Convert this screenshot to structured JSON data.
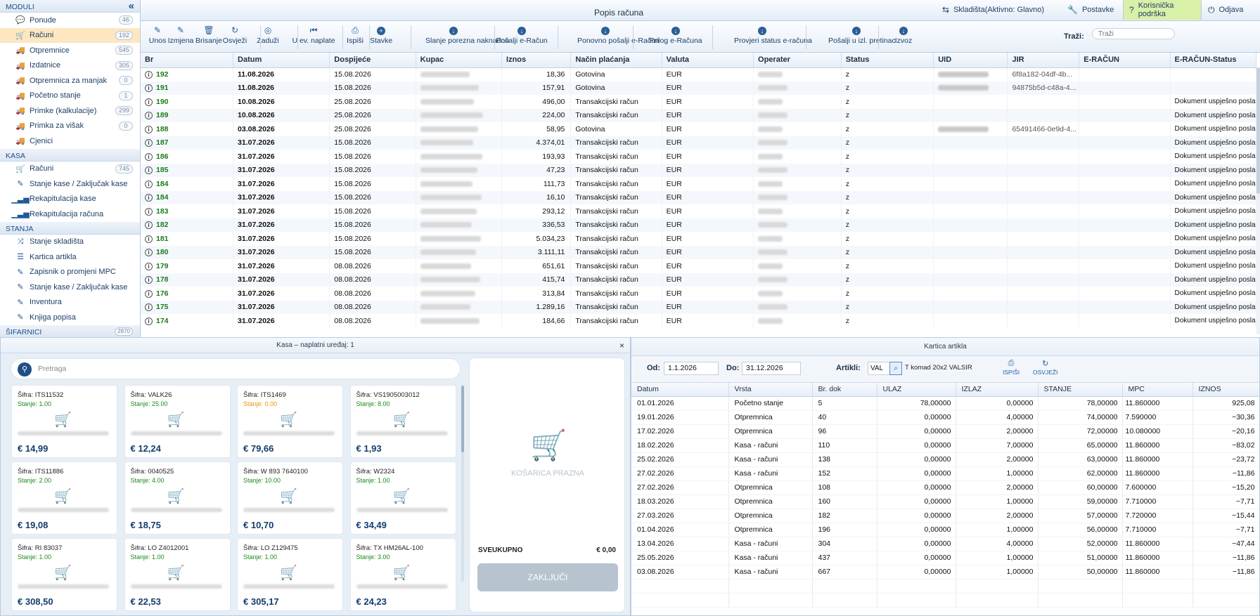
{
  "sidebar": {
    "sections": [
      {
        "title": "MODULI",
        "items": [
          {
            "label": "Ponude",
            "count": "46",
            "icon": "chat-bubble-icon"
          },
          {
            "label": "Računi",
            "count": "192",
            "icon": "cart-icon",
            "active": true
          },
          {
            "label": "Otpremnice",
            "count": "545",
            "icon": "truck-icon"
          },
          {
            "label": "Izdatnice",
            "count": "305",
            "icon": "truck-icon"
          },
          {
            "label": "Otpremnica za manjak",
            "count": "0",
            "icon": "truck-icon"
          },
          {
            "label": "Početno stanje",
            "count": "1",
            "icon": "truck-icon"
          },
          {
            "label": "Primke (kalkulacije)",
            "count": "299",
            "icon": "truck-icon"
          },
          {
            "label": "Primka za višak",
            "count": "0",
            "icon": "truck-icon"
          },
          {
            "label": "Cjenici",
            "count": "",
            "icon": "truck-icon"
          }
        ]
      },
      {
        "title": "KASA",
        "items": [
          {
            "label": "Računi",
            "count": "745",
            "icon": "cart-icon"
          },
          {
            "label": "Stanje kase / Zaključak kase",
            "count": "",
            "icon": "edit-icon"
          },
          {
            "label": "Rekapitulacija kase",
            "count": "",
            "icon": "bar-chart-icon"
          },
          {
            "label": "Rekapitulacija računa",
            "count": "",
            "icon": "bar-chart-icon"
          }
        ]
      },
      {
        "title": "STANJA",
        "items": [
          {
            "label": "Stanje skladišta",
            "count": "",
            "icon": "shuffle-icon"
          },
          {
            "label": "Kartica artikla",
            "count": "",
            "icon": "list-icon"
          },
          {
            "label": "Zapisnik o promjeni MPC",
            "count": "",
            "icon": "edit-icon"
          },
          {
            "label": "Stanje kase / Zaključak kase",
            "count": "",
            "icon": "edit-icon"
          },
          {
            "label": "Inventura",
            "count": "",
            "icon": "edit-icon"
          },
          {
            "label": "Knjiga popisa",
            "count": "",
            "icon": "edit-icon"
          }
        ]
      },
      {
        "title": "ŠIFARNICI",
        "items": [],
        "count": "2870"
      }
    ]
  },
  "topbar": {
    "title": "Popis računa",
    "warehouse": "Skladišta(Aktivno: Glavno)",
    "settings": "Postavke",
    "support": "Korisnička podrška",
    "logout": "Odjava"
  },
  "toolbar": {
    "buttons": [
      {
        "label": "Unos",
        "icon": "pencil-icon"
      },
      {
        "label": "Izmjena",
        "icon": "edit-icon"
      },
      {
        "label": "Brisanje",
        "icon": "trash-icon"
      },
      {
        "label": "Osvježi",
        "icon": "refresh-icon"
      },
      {
        "label": "Zaduži",
        "icon": "target-icon"
      },
      {
        "label": "U ev. naplate",
        "icon": "skip-back-icon"
      },
      {
        "label": "Ispiši",
        "icon": "printer-icon"
      },
      {
        "label": "Stavke",
        "icon": "plus-circle-icon"
      },
      {
        "label": "Slanje porezna naknadno",
        "icon": "arrow-circle-icon"
      },
      {
        "label": "Pošalji e-Račun",
        "icon": "arrow-circle-icon"
      },
      {
        "label": "Ponovno pošalji e-Račun",
        "icon": "arrow-circle-icon"
      },
      {
        "label": "Prilog e-Računa",
        "icon": "arrow-circle-icon"
      },
      {
        "label": "Provjeri status e-računa",
        "icon": "arrow-circle-icon"
      },
      {
        "label": "Pošalji u izl. pretinac",
        "icon": "arrow-circle-icon"
      },
      {
        "label": "Izvoz",
        "icon": "arrow-circle-icon"
      }
    ],
    "search_label": "Traži:",
    "search_placeholder": "Traži"
  },
  "invoices": {
    "columns": [
      "Br",
      "Datum",
      "Dospijeće",
      "Kupac",
      "Iznos",
      "Način plaćanja",
      "Valuta",
      "Operater",
      "Status",
      "UID",
      "JIR",
      "E-RAČUN",
      "E-RAČUN-Status"
    ],
    "rows": [
      {
        "br": "192",
        "datum": "11.08.2026",
        "dosp": "15.08.2026",
        "iznos": "18,36",
        "nacin": "Gotovina",
        "valuta": "EUR",
        "status": "z",
        "uid": true,
        "jir": "6f8a182-04df-4b...",
        "erac": ""
      },
      {
        "br": "191",
        "datum": "11.08.2026",
        "dosp": "15.08.2026",
        "iznos": "157,91",
        "nacin": "Gotovina",
        "valuta": "EUR",
        "status": "z",
        "uid": true,
        "jir": "94875b5d-c48a-4...",
        "erac": ""
      },
      {
        "br": "190",
        "datum": "10.08.2026",
        "dosp": "25.08.2026",
        "iznos": "496,00",
        "nacin": "Transakcijski račun",
        "valuta": "EUR",
        "status": "z",
        "uid": false,
        "jir": "",
        "erac": "Dokument uspješno poslan"
      },
      {
        "br": "189",
        "datum": "10.08.2026",
        "dosp": "25.08.2026",
        "iznos": "224,00",
        "nacin": "Transakcijski račun",
        "valuta": "EUR",
        "status": "z",
        "uid": false,
        "jir": "",
        "erac": "Dokument uspješno poslan"
      },
      {
        "br": "188",
        "datum": "03.08.2026",
        "dosp": "25.08.2026",
        "iznos": "58,95",
        "nacin": "Gotovina",
        "valuta": "EUR",
        "status": "z",
        "uid": true,
        "jir": "65491466-0e9d-4...",
        "erac": "Dokument uspješno poslan"
      },
      {
        "br": "187",
        "datum": "31.07.2026",
        "dosp": "15.08.2026",
        "iznos": "4.374,01",
        "nacin": "Transakcijski račun",
        "valuta": "EUR",
        "status": "z",
        "uid": false,
        "jir": "",
        "erac": "Dokument uspješno poslan"
      },
      {
        "br": "186",
        "datum": "31.07.2026",
        "dosp": "15.08.2026",
        "iznos": "193,93",
        "nacin": "Transakcijski račun",
        "valuta": "EUR",
        "status": "z",
        "uid": false,
        "jir": "",
        "erac": "Dokument uspješno poslan"
      },
      {
        "br": "185",
        "datum": "31.07.2026",
        "dosp": "15.08.2026",
        "iznos": "47,23",
        "nacin": "Transakcijski račun",
        "valuta": "EUR",
        "status": "z",
        "uid": false,
        "jir": "",
        "erac": "Dokument uspješno poslan"
      },
      {
        "br": "184",
        "datum": "31.07.2026",
        "dosp": "15.08.2026",
        "iznos": "111,73",
        "nacin": "Transakcijski račun",
        "valuta": "EUR",
        "status": "z",
        "uid": false,
        "jir": "",
        "erac": "Dokument uspješno poslan"
      },
      {
        "br": "184",
        "datum": "31.07.2026",
        "dosp": "15.08.2026",
        "iznos": "16,10",
        "nacin": "Transakcijski račun",
        "valuta": "EUR",
        "status": "z",
        "uid": false,
        "jir": "",
        "erac": "Dokument uspješno poslan"
      },
      {
        "br": "183",
        "datum": "31.07.2026",
        "dosp": "15.08.2026",
        "iznos": "293,12",
        "nacin": "Transakcijski račun",
        "valuta": "EUR",
        "status": "z",
        "uid": false,
        "jir": "",
        "erac": "Dokument uspješno poslan"
      },
      {
        "br": "182",
        "datum": "31.07.2026",
        "dosp": "15.08.2026",
        "iznos": "336,53",
        "nacin": "Transakcijski račun",
        "valuta": "EUR",
        "status": "z",
        "uid": false,
        "jir": "",
        "erac": "Dokument uspješno poslan"
      },
      {
        "br": "181",
        "datum": "31.07.2026",
        "dosp": "15.08.2026",
        "iznos": "5.034,23",
        "nacin": "Transakcijski račun",
        "valuta": "EUR",
        "status": "z",
        "uid": false,
        "jir": "",
        "erac": "Dokument uspješno poslan"
      },
      {
        "br": "180",
        "datum": "31.07.2026",
        "dosp": "15.08.2026",
        "iznos": "3.111,11",
        "nacin": "Transakcijski račun",
        "valuta": "EUR",
        "status": "z",
        "uid": false,
        "jir": "",
        "erac": "Dokument uspješno poslan"
      },
      {
        "br": "179",
        "datum": "31.07.2026",
        "dosp": "08.08.2026",
        "iznos": "651,61",
        "nacin": "Transakcijski račun",
        "valuta": "EUR",
        "status": "z",
        "uid": false,
        "jir": "",
        "erac": "Dokument uspješno poslan"
      },
      {
        "br": "178",
        "datum": "31.07.2026",
        "dosp": "08.08.2026",
        "iznos": "415,74",
        "nacin": "Transakcijski račun",
        "valuta": "EUR",
        "status": "z",
        "uid": false,
        "jir": "",
        "erac": "Dokument uspješno poslan"
      },
      {
        "br": "176",
        "datum": "31.07.2026",
        "dosp": "08.08.2026",
        "iznos": "313,84",
        "nacin": "Transakcijski račun",
        "valuta": "EUR",
        "status": "z",
        "uid": false,
        "jir": "",
        "erac": "Dokument uspješno poslan"
      },
      {
        "br": "175",
        "datum": "31.07.2026",
        "dosp": "08.08.2026",
        "iznos": "1.289,16",
        "nacin": "Transakcijski račun",
        "valuta": "EUR",
        "status": "z",
        "uid": false,
        "jir": "",
        "erac": "Dokument uspješno poslan"
      },
      {
        "br": "174",
        "datum": "31.07.2026",
        "dosp": "08.08.2026",
        "iznos": "184,66",
        "nacin": "Transakcijski račun",
        "valuta": "EUR",
        "status": "z",
        "uid": false,
        "jir": "",
        "erac": "Dokument uspješno poslan"
      }
    ]
  },
  "kasa": {
    "title": "Kasa – naplatni uređaj: 1",
    "search_placeholder": "Pretraga",
    "products": [
      {
        "sifra": "Šifra: ITS11532",
        "stanje": "Stanje: 1.00",
        "zero": false,
        "price": "€ 14,99"
      },
      {
        "sifra": "Šifra: VALK26",
        "stanje": "Stanje: 25.00",
        "zero": false,
        "price": "€ 12,24"
      },
      {
        "sifra": "Šifra: ITS1469",
        "stanje": "Stanje: 0.00",
        "zero": true,
        "price": "€ 79,66"
      },
      {
        "sifra": "Šifra: VS1905003012",
        "stanje": "Stanje: 8.00",
        "zero": false,
        "price": "€ 1,93"
      },
      {
        "sifra": "Šifra: ITS11886",
        "stanje": "Stanje: 2.00",
        "zero": false,
        "price": "€ 19,08"
      },
      {
        "sifra": "Šifra: 0040525",
        "stanje": "Stanje: 4.00",
        "zero": false,
        "price": "€ 18,75"
      },
      {
        "sifra": "Šifra: W 893 7640100",
        "stanje": "Stanje: 10.00",
        "zero": false,
        "price": "€ 10,70"
      },
      {
        "sifra": "Šifra: W2324",
        "stanje": "Stanje: 1.00",
        "zero": false,
        "price": "€ 34,49"
      },
      {
        "sifra": "Šifra: RI 83037",
        "stanje": "Stanje: 1.00",
        "zero": false,
        "price": "€ 308,50"
      },
      {
        "sifra": "Šifra: LO Z4012001",
        "stanje": "Stanje: 1.00",
        "zero": false,
        "price": "€ 22,53"
      },
      {
        "sifra": "Šifra: LO Z129475",
        "stanje": "Stanje: 1.00",
        "zero": false,
        "price": "€ 305,17"
      },
      {
        "sifra": "Šifra: TX HM26AL-100",
        "stanje": "Stanje: 3.00",
        "zero": false,
        "price": "€ 24,23"
      }
    ],
    "cart_empty": "KOŠARICA PRAZNA",
    "total_label": "SVEUKUPNO",
    "total_value": "€ 0,00",
    "checkout": "ZAKLJUČI"
  },
  "kartica": {
    "title": "Kartica artikla",
    "od_label": "Od:",
    "od_value": "1.1.2026",
    "do_label": "Do:",
    "do_value": "31.12.2026",
    "artikli_label": "Artikli:",
    "artikl_code": "VAL",
    "artikl_name": "T komad 20x2 VALSIR",
    "print_label": "ISPIŠI",
    "refresh_label": "OSVJEŽI",
    "columns": [
      "Datum",
      "Vrsta",
      "Br. dok",
      "ULAZ",
      "IZLAZ",
      "STANJE",
      "MPC",
      "IZNOS"
    ],
    "rows": [
      {
        "datum": "01.01.2026",
        "vrsta": "Početno stanje",
        "brdok": "5",
        "ulaz": "78,00000",
        "izlaz": "0,00000",
        "stanje": "78,00000",
        "mpc": "11.860000",
        "iznos": "925,08"
      },
      {
        "datum": "19.01.2026",
        "vrsta": "Otpremnica",
        "brdok": "40",
        "ulaz": "0,00000",
        "izlaz": "4,00000",
        "stanje": "74,00000",
        "mpc": "7.590000",
        "iznos": "−30,36"
      },
      {
        "datum": "17.02.2026",
        "vrsta": "Otpremnica",
        "brdok": "96",
        "ulaz": "0,00000",
        "izlaz": "2,00000",
        "stanje": "72,00000",
        "mpc": "10.080000",
        "iznos": "−20,16"
      },
      {
        "datum": "18.02.2026",
        "vrsta": "Kasa - računi",
        "brdok": "110",
        "ulaz": "0,00000",
        "izlaz": "7,00000",
        "stanje": "65,00000",
        "mpc": "11.860000",
        "iznos": "−83,02"
      },
      {
        "datum": "25.02.2026",
        "vrsta": "Kasa - računi",
        "brdok": "138",
        "ulaz": "0,00000",
        "izlaz": "2,00000",
        "stanje": "63,00000",
        "mpc": "11.860000",
        "iznos": "−23,72"
      },
      {
        "datum": "27.02.2026",
        "vrsta": "Kasa - računi",
        "brdok": "152",
        "ulaz": "0,00000",
        "izlaz": "1,00000",
        "stanje": "62,00000",
        "mpc": "11.860000",
        "iznos": "−11,86"
      },
      {
        "datum": "27.02.2026",
        "vrsta": "Otpremnica",
        "brdok": "108",
        "ulaz": "0,00000",
        "izlaz": "2,00000",
        "stanje": "60,00000",
        "mpc": "7.600000",
        "iznos": "−15,20"
      },
      {
        "datum": "18.03.2026",
        "vrsta": "Otpremnica",
        "brdok": "160",
        "ulaz": "0,00000",
        "izlaz": "1,00000",
        "stanje": "59,00000",
        "mpc": "7.710000",
        "iznos": "−7,71"
      },
      {
        "datum": "27.03.2026",
        "vrsta": "Otpremnica",
        "brdok": "182",
        "ulaz": "0,00000",
        "izlaz": "2,00000",
        "stanje": "57,00000",
        "mpc": "7.720000",
        "iznos": "−15,44"
      },
      {
        "datum": "01.04.2026",
        "vrsta": "Otpremnica",
        "brdok": "196",
        "ulaz": "0,00000",
        "izlaz": "1,00000",
        "stanje": "56,00000",
        "mpc": "7.710000",
        "iznos": "−7,71"
      },
      {
        "datum": "13.04.2026",
        "vrsta": "Kasa - računi",
        "brdok": "304",
        "ulaz": "0,00000",
        "izlaz": "4,00000",
        "stanje": "52,00000",
        "mpc": "11.860000",
        "iznos": "−47,44"
      },
      {
        "datum": "25.05.2026",
        "vrsta": "Kasa - računi",
        "brdok": "437",
        "ulaz": "0,00000",
        "izlaz": "1,00000",
        "stanje": "51,00000",
        "mpc": "11.860000",
        "iznos": "−11,86"
      },
      {
        "datum": "03.08.2026",
        "vrsta": "Kasa - računi",
        "brdok": "667",
        "ulaz": "0,00000",
        "izlaz": "1,00000",
        "stanje": "50,00000",
        "mpc": "11.860000",
        "iznos": "−11,86"
      }
    ]
  }
}
